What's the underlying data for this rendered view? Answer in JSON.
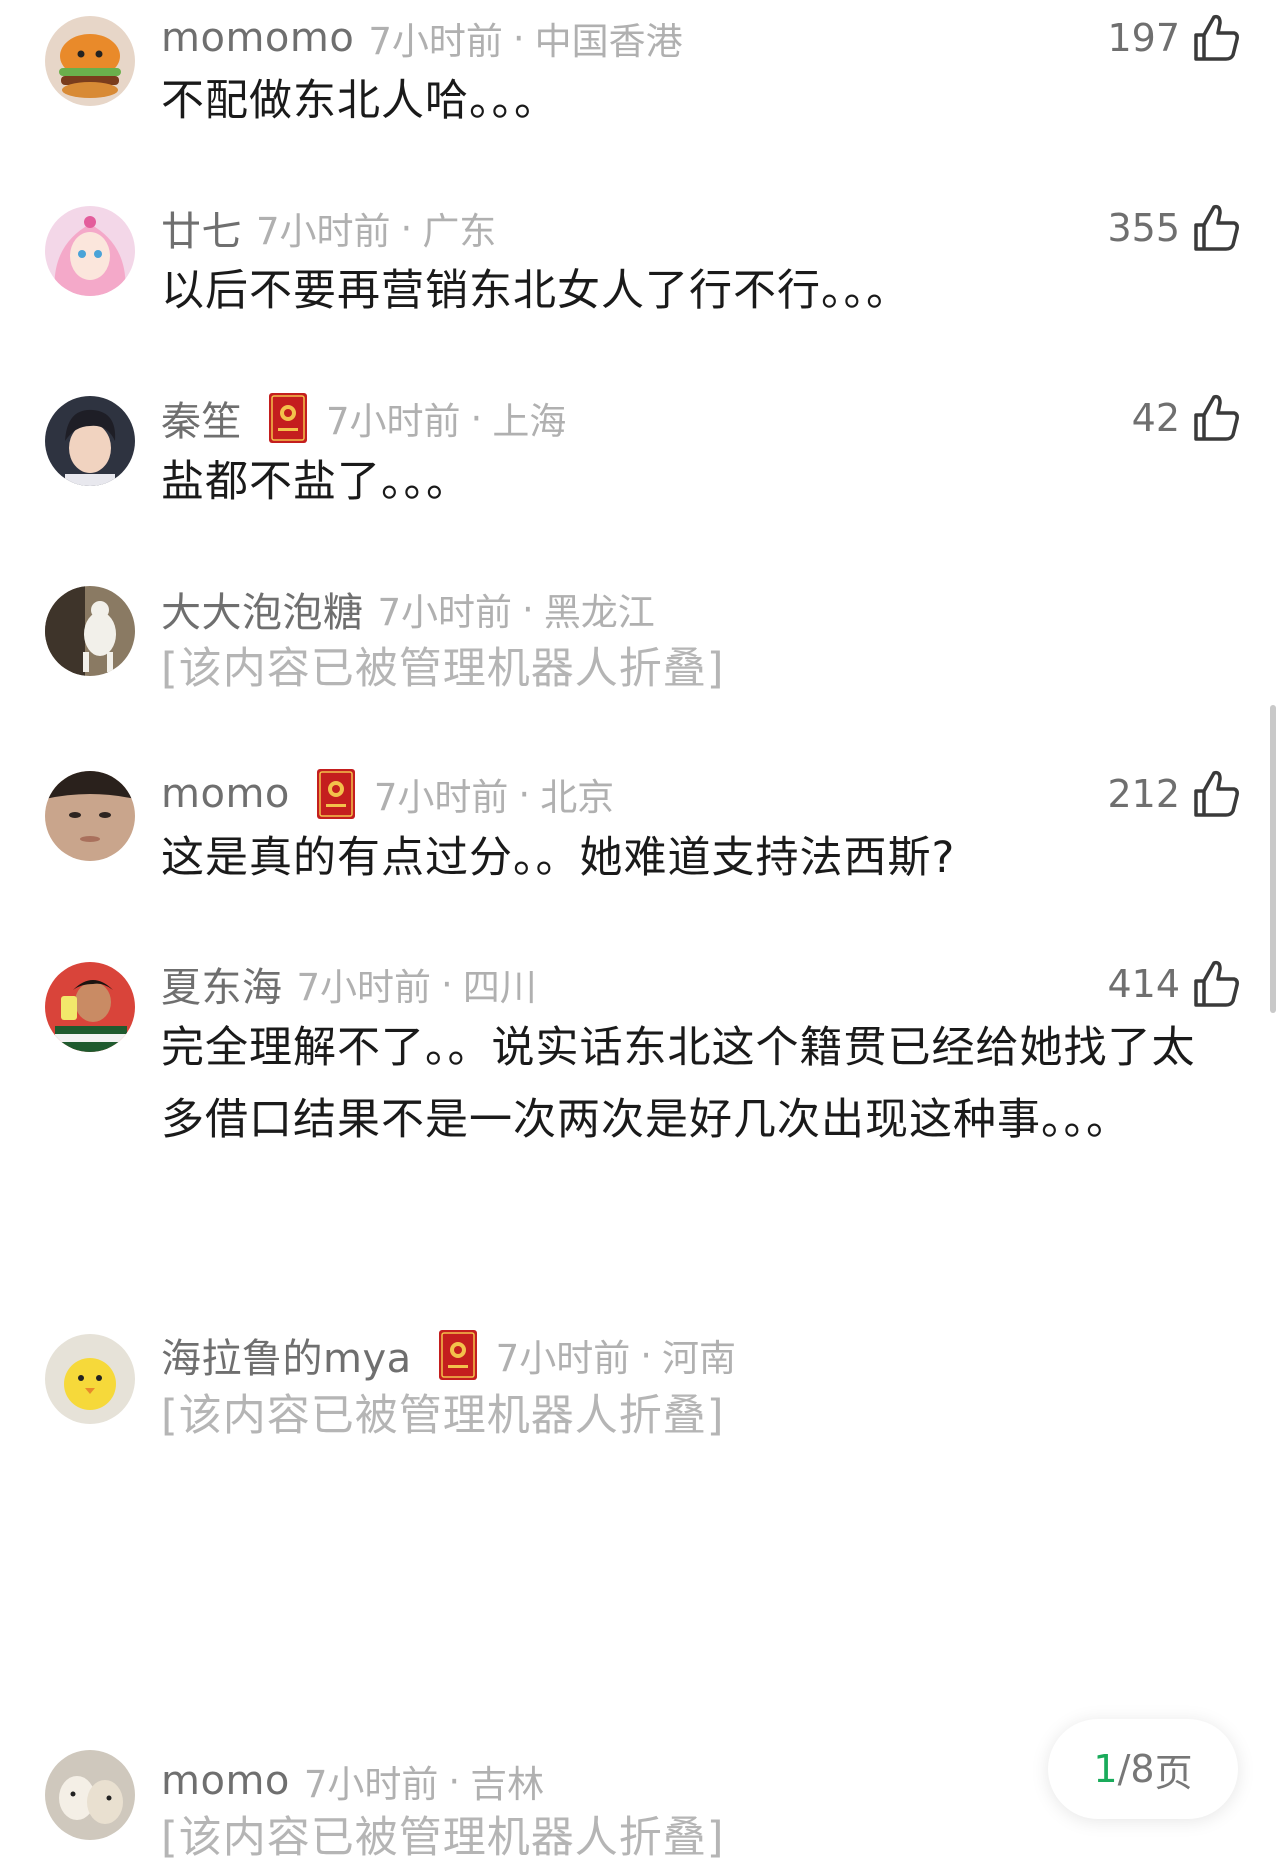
{
  "comments": [
    {
      "user": "momomo",
      "time": "7小时前",
      "region": "中国香港",
      "likes": "197",
      "text": "不配做东北人哈。。。",
      "badge": false,
      "folded": false
    },
    {
      "user": "廿七",
      "time": "7小时前",
      "region": "广东",
      "likes": "355",
      "text": "以后不要再营销东北女人了行不行。。。",
      "badge": false,
      "folded": false
    },
    {
      "user": "秦笙",
      "time": "7小时前",
      "region": "上海",
      "likes": "42",
      "text": "盐都不盐了。。。",
      "badge": true,
      "folded": false
    },
    {
      "user": "大大泡泡糖",
      "time": "7小时前",
      "region": "黑龙江",
      "likes": "",
      "text": "[该内容已被管理机器人折叠]",
      "badge": false,
      "folded": true
    },
    {
      "user": "momo",
      "time": "7小时前",
      "region": "北京",
      "likes": "212",
      "text": "这是真的有点过分。。她难道支持法西斯?",
      "badge": true,
      "folded": false
    },
    {
      "user": "夏东海",
      "time": "7小时前",
      "region": "四川",
      "likes": "414",
      "text": "完全理解不了。。说实话东北这个籍贯已经给她找了太多借口结果不是一次两次是好几次出现这种事。。。",
      "badge": false,
      "folded": false
    },
    {
      "user": "海拉鲁的mya",
      "time": "7小时前",
      "region": "河南",
      "likes": "",
      "text": "[该内容已被管理机器人折叠]",
      "badge": true,
      "folded": true
    },
    {
      "user": "momo",
      "time": "7小时前",
      "region": "吉林",
      "likes": "",
      "text": "[该内容已被管理机器人折叠]",
      "badge": false,
      "folded": true
    }
  ],
  "separator": "·",
  "pager": {
    "current": "1",
    "total": "/8",
    "suffix": " 页"
  },
  "colors": {
    "username": "#6f6f6f",
    "meta": "#b0b0b0",
    "text": "#1a1a1a",
    "folded": "#b5b5b5",
    "pager_accent": "#1aab5b",
    "badge": "#c41e1e"
  },
  "icons": {
    "like": "thumbs-up-outline-icon",
    "badge": "red-book-badge-icon",
    "scrollbar": "scrollbar-thumb"
  }
}
